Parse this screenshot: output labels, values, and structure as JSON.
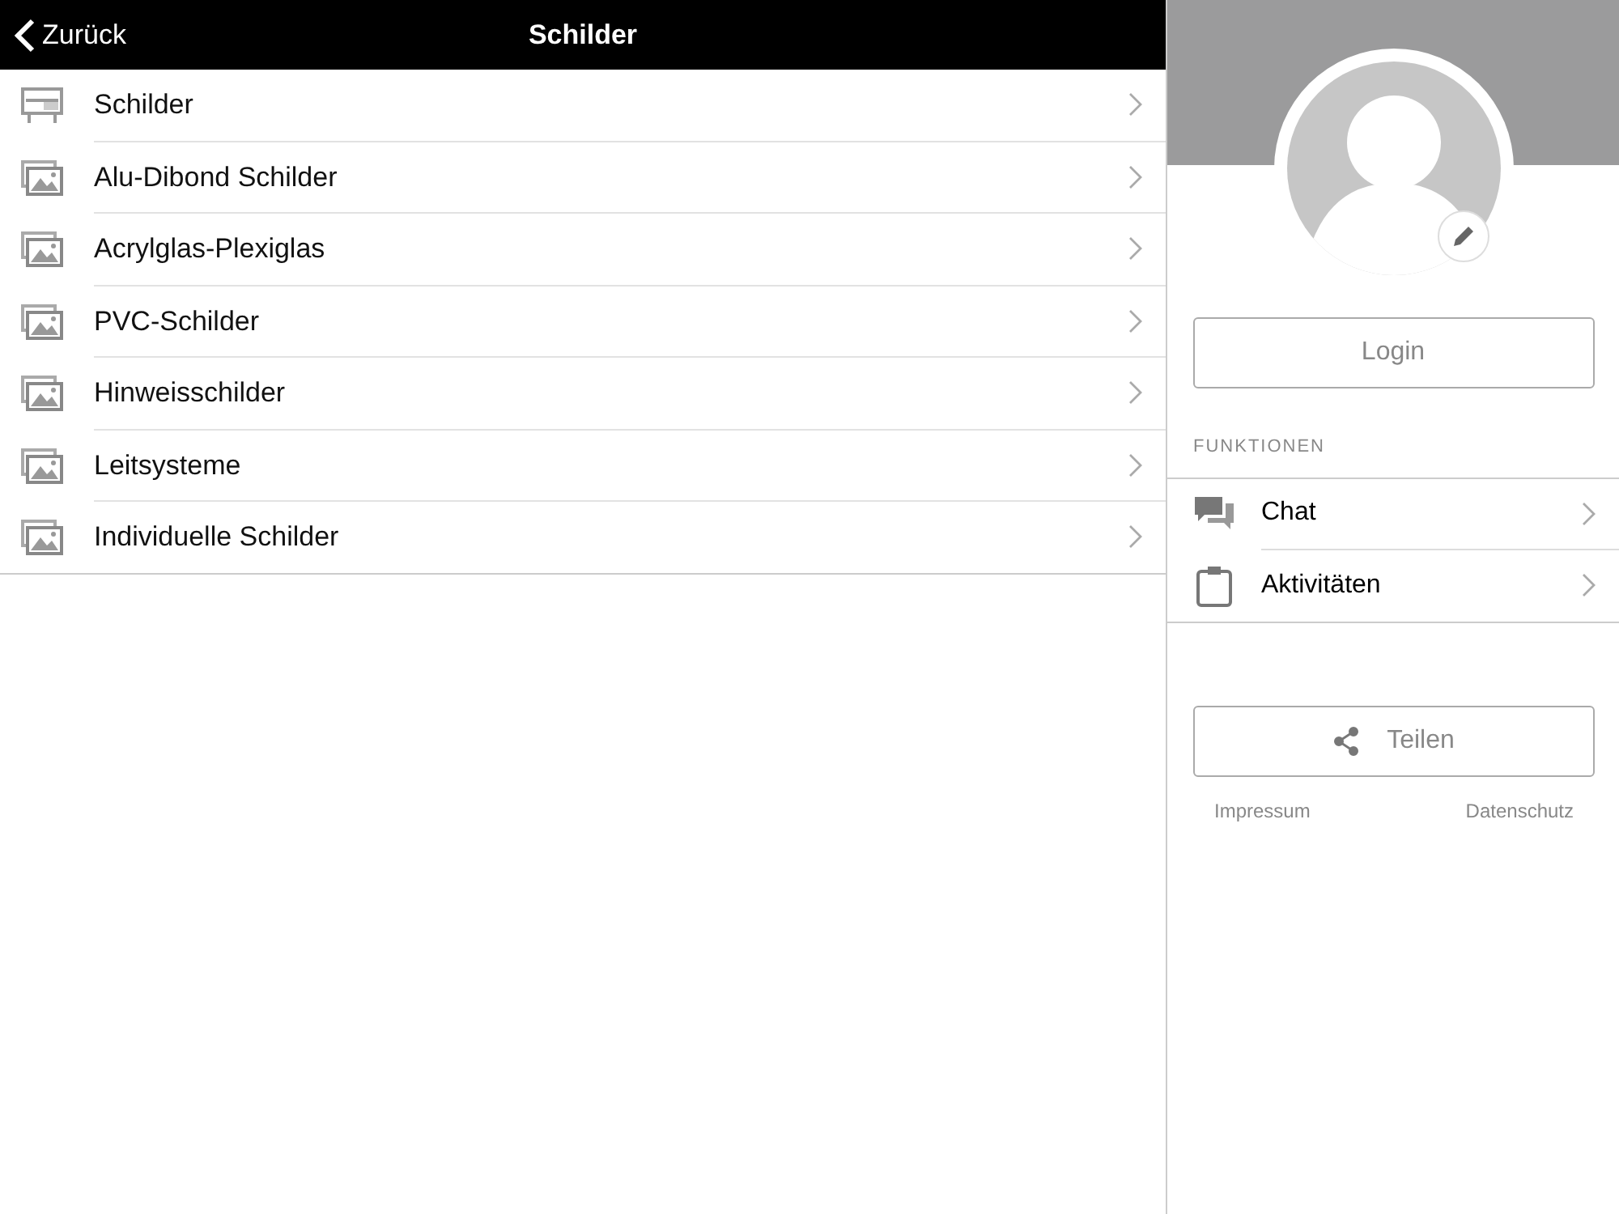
{
  "header": {
    "back": "Zurück",
    "title": "Schilder"
  },
  "items": [
    {
      "kind": "sign",
      "label": "Schilder"
    },
    {
      "kind": "image",
      "label": "Alu-Dibond Schilder"
    },
    {
      "kind": "image",
      "label": "Acrylglas-Plexiglas"
    },
    {
      "kind": "image",
      "label": "PVC-Schilder"
    },
    {
      "kind": "image",
      "label": "Hinweisschilder"
    },
    {
      "kind": "image",
      "label": "Leitsysteme"
    },
    {
      "kind": "image",
      "label": "Individuelle Schilder"
    }
  ],
  "sidebar": {
    "login": "Login",
    "section": "FUNKTIONEN",
    "functions": [
      {
        "kind": "chat",
        "label": "Chat"
      },
      {
        "kind": "clipboard",
        "label": "Aktivitäten"
      }
    ],
    "share": "Teilen",
    "links": [
      "Impressum",
      "Datenschutz"
    ]
  }
}
